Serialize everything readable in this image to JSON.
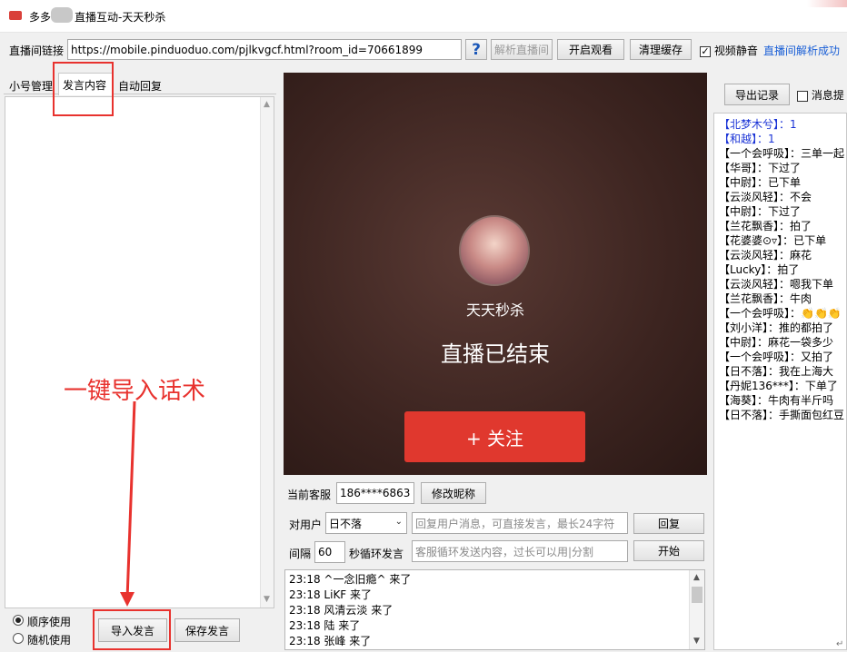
{
  "window": {
    "title_prefix": "多多",
    "title_suffix": "直播互动-天天秒杀"
  },
  "toolbar": {
    "url_label": "直播间链接",
    "url_value": "https://mobile.pinduoduo.com/pjlkvgcf.html?room_id=70661899",
    "help_glyph": "?",
    "parse_button": "解析直播间",
    "watch_button": "开启观看",
    "clear_button": "清理缓存",
    "mute_label": "视频静音",
    "status_text": "直播间解析成功"
  },
  "tabs": [
    {
      "label": "小号管理"
    },
    {
      "label": "发言内容"
    },
    {
      "label": "自动回复"
    }
  ],
  "left": {
    "annotation": "一键导入话术",
    "order_mode": "顺序使用",
    "random_mode": "随机使用",
    "import_button": "导入发言",
    "save_button": "保存发言"
  },
  "video": {
    "streamer_name": "天天秒杀",
    "ended_text": "直播已结束",
    "follow_button": "+ 关注"
  },
  "controls": {
    "service_label": "当前客服",
    "service_value": "186****6863",
    "rename_button": "修改昵称",
    "target_label": "对用户",
    "target_value": "日不落",
    "reply_placeholder": "回复用户消息，可直接发言，最长24字符",
    "reply_button": "回复",
    "interval_label": "间隔",
    "interval_value": "60",
    "loop_label": "秒循环发言",
    "loop_placeholder": "客服循环发送内容，过长可以用|分割",
    "start_button": "开始"
  },
  "log": [
    {
      "time": "23:18",
      "text": "^一念旧瘾^ 来了"
    },
    {
      "time": "23:18",
      "text": "LiKF 来了"
    },
    {
      "time": "23:18",
      "text": "风清云淡 来了"
    },
    {
      "time": "23:18",
      "text": "陆 来了"
    },
    {
      "time": "23:18",
      "text": "张峰 来了"
    }
  ],
  "right": {
    "export_button": "导出记录",
    "msg_checkbox_label": "消息提",
    "chat": [
      {
        "user": "【北梦木兮】：",
        "msg": "1",
        "color": "#1a33d6"
      },
      {
        "user": "【和越】：",
        "msg": "1",
        "color": "#1a33d6"
      },
      {
        "user": "【一个会呼吸】：",
        "msg": "三单一起",
        "color": "#000000"
      },
      {
        "user": "【华哥】：",
        "msg": "下过了",
        "color": "#000000"
      },
      {
        "user": "【中尉】：",
        "msg": "已下单",
        "color": "#000000"
      },
      {
        "user": "【云淡风轻】：",
        "msg": "不会",
        "color": "#000000"
      },
      {
        "user": "【中尉】：",
        "msg": "下过了",
        "color": "#000000"
      },
      {
        "user": "【兰花飘香】：",
        "msg": "拍了",
        "color": "#000000"
      },
      {
        "user": "【花婆婆⊙▿】：",
        "msg": "已下单",
        "color": "#000000"
      },
      {
        "user": "【云淡风轻】：",
        "msg": "麻花",
        "color": "#000000"
      },
      {
        "user": "【Lucky】：",
        "msg": "拍了",
        "color": "#000000"
      },
      {
        "user": "【云淡风轻】：",
        "msg": "嗯我下单",
        "color": "#000000"
      },
      {
        "user": "【兰花飘香】：",
        "msg": "牛肉",
        "color": "#000000"
      },
      {
        "user": "【一个会呼吸】：",
        "msg": "👏👏👏",
        "color": "#000000"
      },
      {
        "user": "【刘小洋】：",
        "msg": "推的都拍了",
        "color": "#000000"
      },
      {
        "user": "【中尉】：",
        "msg": "麻花一袋多少",
        "color": "#000000"
      },
      {
        "user": "【一个会呼吸】：",
        "msg": "又拍了",
        "color": "#000000"
      },
      {
        "user": "【日不落】：",
        "msg": "我在上海大",
        "color": "#000000"
      },
      {
        "user": "【丹妮136***】：",
        "msg": "下单了",
        "color": "#000000"
      },
      {
        "user": "【海葵】：",
        "msg": "牛肉有半斤吗",
        "color": "#000000"
      },
      {
        "user": "【日不落】：",
        "msg": "手撕面包红豆",
        "color": "#000000"
      }
    ]
  },
  "colors": {
    "accent_red": "#e8322e",
    "link_blue": "#1a5fd6",
    "video_bg": "#4a2a24",
    "follow_red": "#e0382e"
  }
}
